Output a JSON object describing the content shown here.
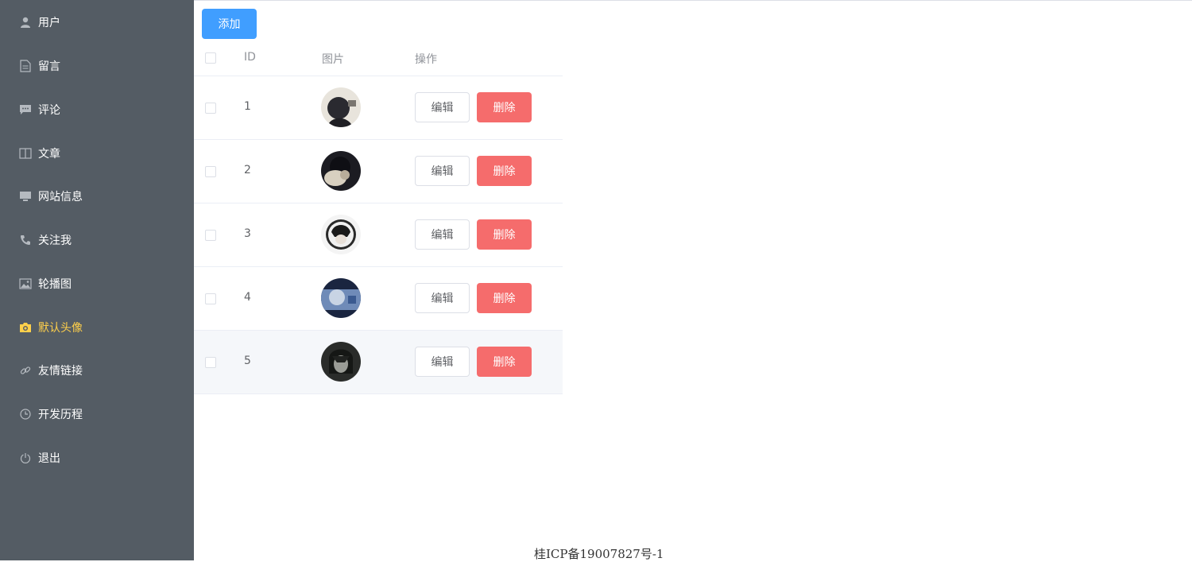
{
  "sidebar": {
    "items": [
      {
        "label": "用户",
        "icon": "user-icon"
      },
      {
        "label": "留言",
        "icon": "document-icon"
      },
      {
        "label": "评论",
        "icon": "chat-icon"
      },
      {
        "label": "文章",
        "icon": "book-icon"
      },
      {
        "label": "网站信息",
        "icon": "monitor-icon"
      },
      {
        "label": "关注我",
        "icon": "phone-icon"
      },
      {
        "label": "轮播图",
        "icon": "picture-icon"
      },
      {
        "label": "默认头像",
        "icon": "camera-icon",
        "active": true
      },
      {
        "label": "友情链接",
        "icon": "link-icon"
      },
      {
        "label": "开发历程",
        "icon": "clock-icon"
      },
      {
        "label": "退出",
        "icon": "power-icon"
      }
    ],
    "active_color": "#ffd04b",
    "background": "#545c64"
  },
  "toolbar": {
    "add_label": "添加"
  },
  "table": {
    "headers": {
      "id": "ID",
      "image": "图片",
      "actions": "操作"
    },
    "rows": [
      {
        "id": "1",
        "edit": "编辑",
        "delete": "删除"
      },
      {
        "id": "2",
        "edit": "编辑",
        "delete": "删除"
      },
      {
        "id": "3",
        "edit": "编辑",
        "delete": "删除"
      },
      {
        "id": "4",
        "edit": "编辑",
        "delete": "删除"
      },
      {
        "id": "5",
        "edit": "编辑",
        "delete": "删除"
      }
    ]
  },
  "footer": {
    "icp": "桂ICP备19007827号-1"
  },
  "colors": {
    "primary": "#409eff",
    "danger": "#f56c6c"
  }
}
